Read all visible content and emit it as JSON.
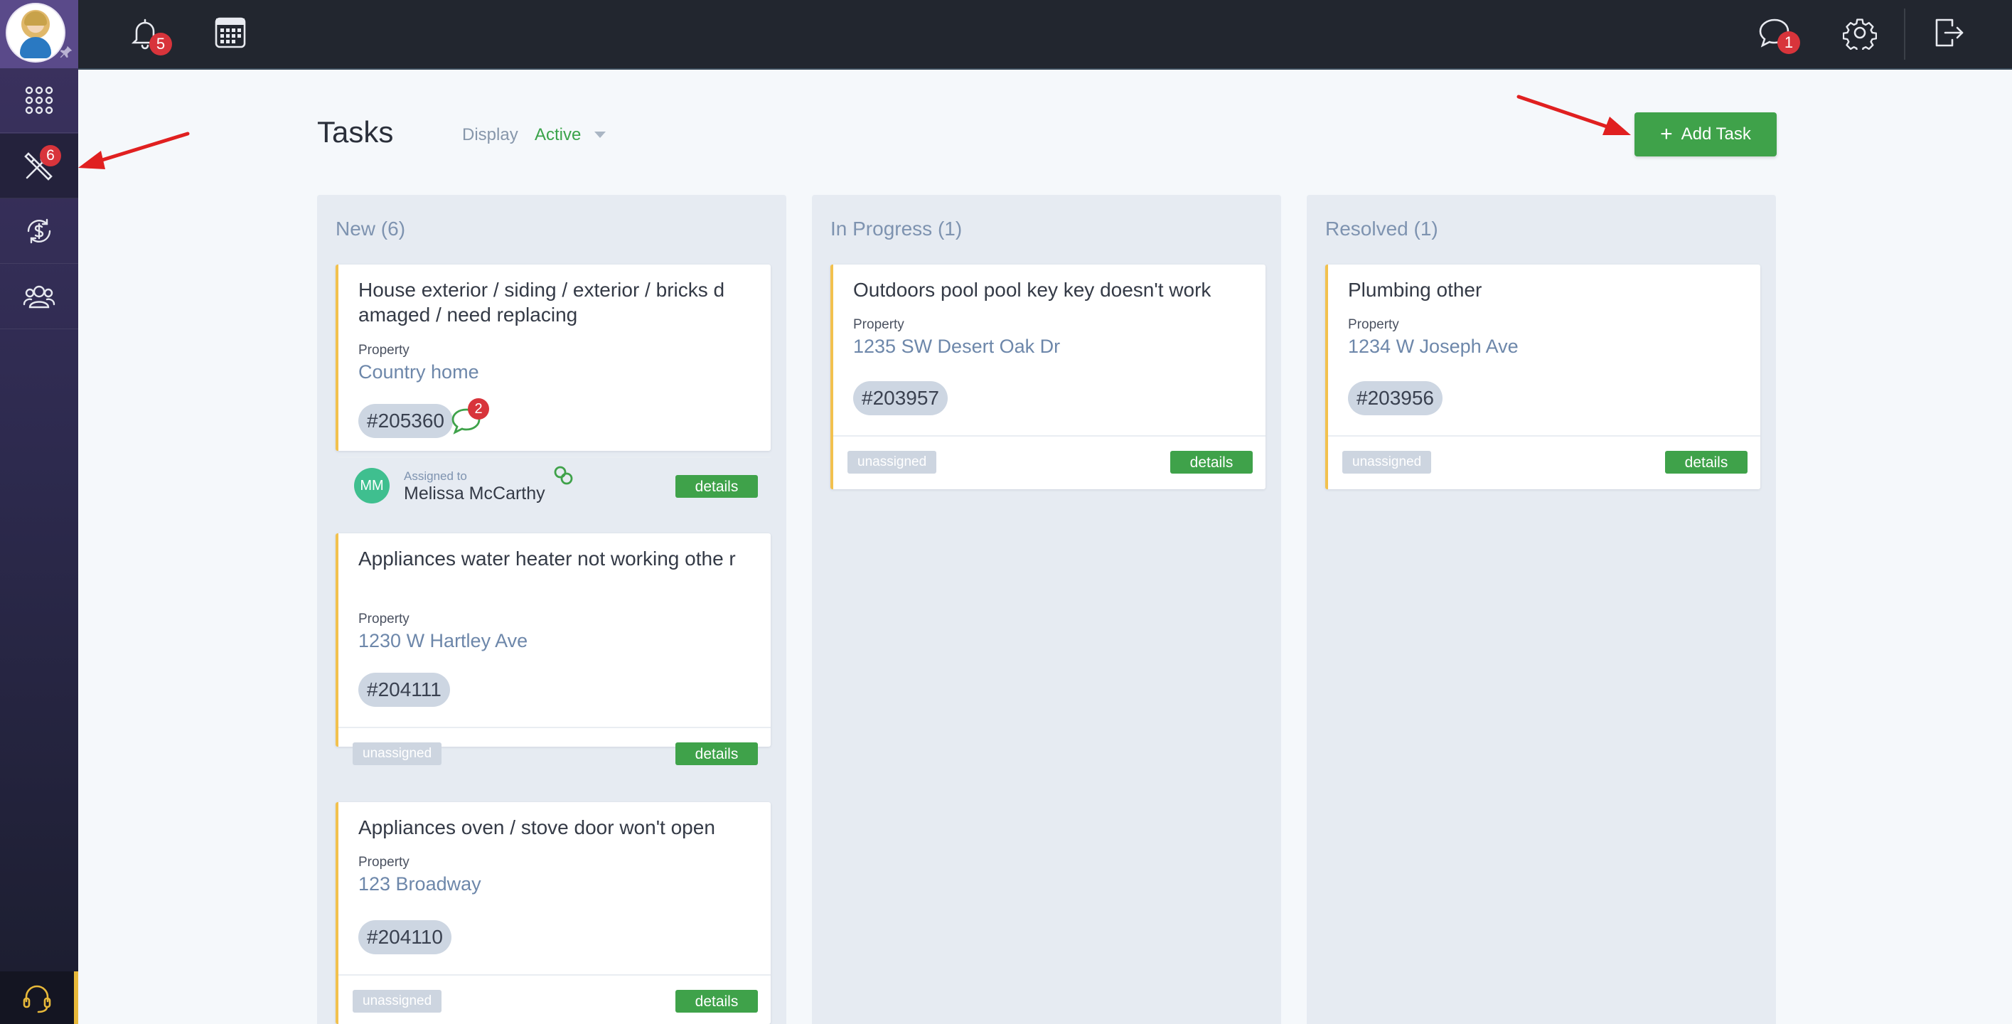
{
  "topbar": {
    "notifications_badge": "5",
    "messages_badge": "1",
    "icons": [
      "bell-icon",
      "calendar-icon",
      "chat-icon",
      "gear-icon",
      "logout-icon"
    ]
  },
  "sidebar": {
    "items": [
      {
        "name": "apps",
        "icon": "grid-icon"
      },
      {
        "name": "maintenance",
        "icon": "tools-icon",
        "badge": "6"
      },
      {
        "name": "payments",
        "icon": "dollar-cycle-icon"
      },
      {
        "name": "contacts",
        "icon": "users-icon"
      }
    ],
    "support_icon": "headset-icon"
  },
  "header": {
    "title": "Tasks",
    "display_label": "Display",
    "display_value": "Active",
    "add_task_label": "Add Task"
  },
  "common": {
    "property_label": "Property",
    "unassigned_label": "unassigned",
    "details_label": "details",
    "assigned_to_label": "Assigned to"
  },
  "columns": [
    {
      "title": "New (6)",
      "cards": [
        {
          "title": "House exterior / siding / exterior / bricks d amaged / need replacing",
          "property": "Country home",
          "ticket": "#205360",
          "comments_badge": "2",
          "assignee_initials": "MM",
          "assignee_name": "Melissa McCarthy"
        },
        {
          "title": "Appliances water heater not working othe r",
          "property": "1230 W Hartley Ave",
          "ticket": "#204111"
        },
        {
          "title": "Appliances oven / stove door won't open",
          "property": "123 Broadway",
          "ticket": "#204110"
        }
      ]
    },
    {
      "title": "In Progress (1)",
      "cards": [
        {
          "title": "Outdoors pool pool key key doesn't work",
          "property": "1235 SW Desert Oak Dr",
          "ticket": "#203957"
        }
      ]
    },
    {
      "title": "Resolved (1)",
      "cards": [
        {
          "title": "Plumbing other",
          "property": "1234 W Joseph Ave",
          "ticket": "#203956"
        }
      ]
    }
  ],
  "colors": {
    "accent_green": "#3fa24a",
    "badge_red": "#d8343b",
    "card_border": "#f2c14e",
    "link_blue": "#6d87aa"
  }
}
